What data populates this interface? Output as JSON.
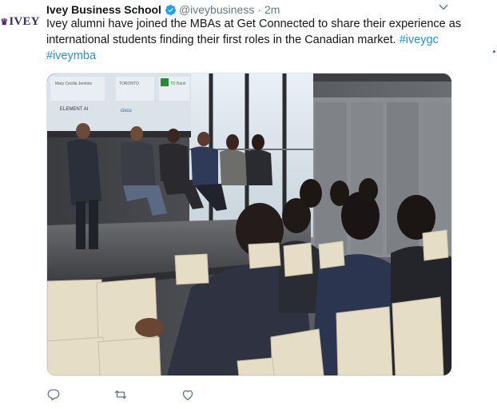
{
  "account": {
    "logo_text": "IVEY",
    "name": "Ivey Business School",
    "handle": "@iveybusiness",
    "separator": "·",
    "timestamp": "2m"
  },
  "tweet": {
    "line1": "Ivey alumni have joined the MBAs at Get Connected to share their experience as",
    "line2_text": "international students finding their first roles in the Canadian market.",
    "hashtag_1": "#iveygc",
    "hashtag_2": "#iveymba"
  },
  "media": {
    "screen_slides": {
      "left_title": "Mary Cecilia Jenkins",
      "sponsor_1": "TORONTO",
      "sponsor_2": "TD Bank",
      "sponsor_3": "ELEMENT AI",
      "sponsor_4": "cisco"
    }
  },
  "actions": {
    "reply_icon": "reply-icon",
    "retweet_icon": "retweet-icon",
    "like_icon": "like-icon"
  },
  "colors": {
    "link": "#1b95e0",
    "secondary_text": "#657786",
    "verified": "#1da1f2",
    "brand_purple": "#4f2683"
  }
}
